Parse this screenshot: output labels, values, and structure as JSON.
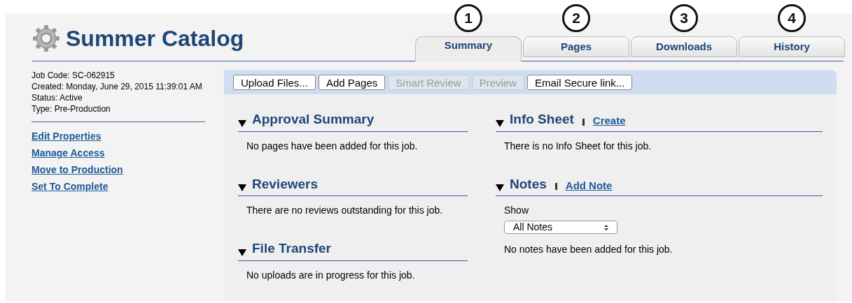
{
  "title": "Summer Catalog",
  "tabs": [
    {
      "number": "1",
      "label": "Summary",
      "selected": true
    },
    {
      "number": "2",
      "label": "Pages",
      "selected": false
    },
    {
      "number": "3",
      "label": "Downloads",
      "selected": false
    },
    {
      "number": "4",
      "label": "History",
      "selected": false
    }
  ],
  "job_info": [
    "Job Code: SC-062915",
    "Created: Monday, June 29, 2015 11:39:01 AM",
    "Status: Active",
    "Type: Pre-Production"
  ],
  "sidebar_links": [
    "Edit Properties",
    "Manage Access",
    "Move to Production",
    "Set To Complete"
  ],
  "toolbar": [
    {
      "label": "Upload Files...",
      "disabled": false
    },
    {
      "label": "Add Pages",
      "disabled": false
    },
    {
      "label": "Smart Review",
      "disabled": true
    },
    {
      "label": "Preview",
      "disabled": true
    },
    {
      "label": "Email Secure link...",
      "disabled": false
    }
  ],
  "left_sections": [
    {
      "title": "Approval Summary",
      "expanded": true,
      "text": "No pages have been added for this job."
    },
    {
      "title": "Reviewers",
      "expanded": true,
      "text": "There are no reviews outstanding for this job."
    },
    {
      "title": "File Transfer",
      "expanded": true,
      "text": "No uploads are in progress for this job."
    }
  ],
  "right_sections": [
    {
      "title": "Info Sheet",
      "expanded": true,
      "action": "Create",
      "text": "There is no Info Sheet for this job."
    },
    {
      "title": "Notes",
      "expanded": true,
      "action": "Add Note",
      "show_label": "Show",
      "filter": "All Notes",
      "text": "No notes have been added for this job."
    }
  ]
}
